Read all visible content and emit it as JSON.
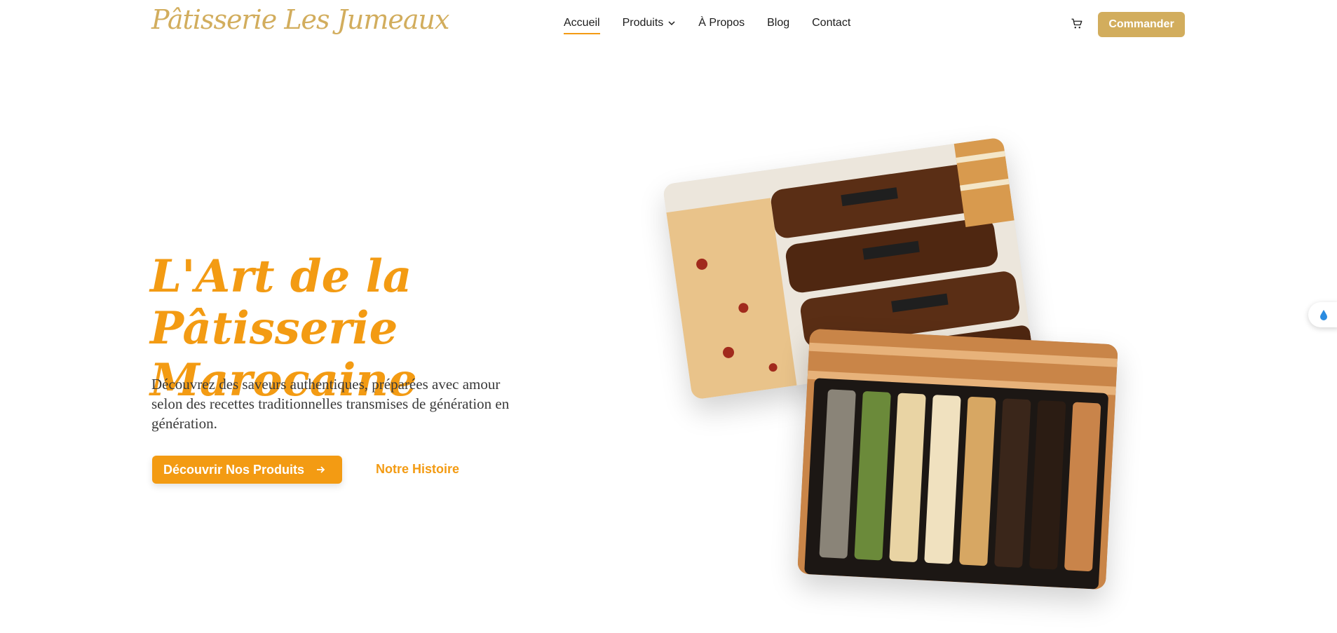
{
  "header": {
    "logo": "Pâtisserie Les Jumeaux",
    "nav": [
      {
        "label": "Accueil",
        "active": true
      },
      {
        "label": "Produits",
        "dropdown": true
      },
      {
        "label": "À Propos"
      },
      {
        "label": "Blog"
      },
      {
        "label": "Contact"
      }
    ],
    "cart_icon": "cart-icon",
    "cta_label": "Commander"
  },
  "hero": {
    "title": "L'Art de la Pâtisserie Marocaine",
    "subtitle": "Découvrez des saveurs authentiques, préparées avec amour selon des recettes traditionnelles transmises de génération en génération.",
    "primary_button": "Découvrir Nos Produits",
    "secondary_button": "Notre Histoire"
  },
  "colors": {
    "accent": "#f39b13",
    "gold": "#d2ad5d",
    "text": "#3a3a3a"
  }
}
